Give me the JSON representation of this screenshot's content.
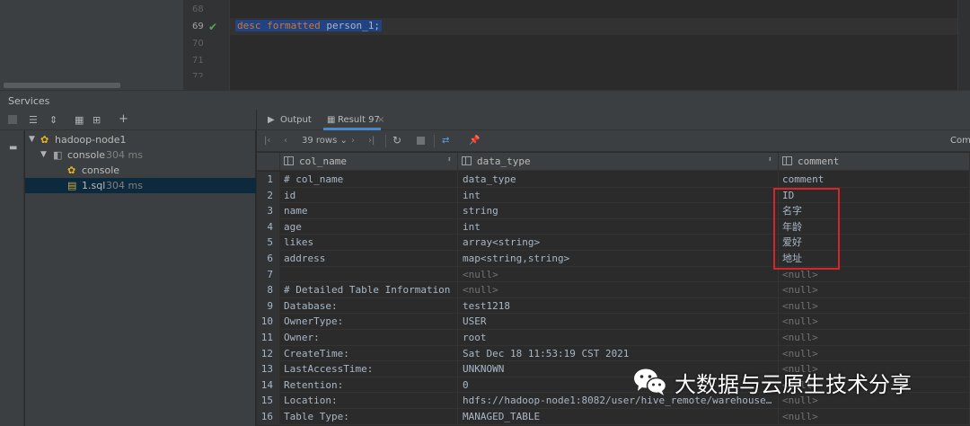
{
  "editor": {
    "lines": [
      {
        "num": "68",
        "code": ""
      },
      {
        "num": "69",
        "code": "desc formatted person_1;"
      },
      {
        "num": "70",
        "code": ""
      },
      {
        "num": "71",
        "code": ""
      }
    ],
    "keyword1": "desc",
    "keyword2": "formatted",
    "table": "person_1;"
  },
  "services": {
    "title": "Services",
    "tree": [
      {
        "label": "hadoop-node1",
        "duration": ""
      },
      {
        "label": "console",
        "duration": "304 ms"
      },
      {
        "label": "console",
        "duration": ""
      },
      {
        "label": "1.sql",
        "duration": "304 ms"
      }
    ]
  },
  "tabs": {
    "output": "Output",
    "result": "Result 97"
  },
  "result_toolbar": {
    "rows_label": "39 rows",
    "right_label": "Comm"
  },
  "grid": {
    "columns": [
      "col_name",
      "data_type",
      "comment"
    ],
    "rows": [
      {
        "n": "1",
        "col_name": "# col_name",
        "data_type": "data_type",
        "comment": "comment"
      },
      {
        "n": "2",
        "col_name": "id",
        "data_type": "int",
        "comment": "ID"
      },
      {
        "n": "3",
        "col_name": "name",
        "data_type": "string",
        "comment": "名字"
      },
      {
        "n": "4",
        "col_name": "age",
        "data_type": "int",
        "comment": "年龄"
      },
      {
        "n": "5",
        "col_name": "likes",
        "data_type": "array<string>",
        "comment": "爱好"
      },
      {
        "n": "6",
        "col_name": "address",
        "data_type": "map<string,string>",
        "comment": "地址"
      },
      {
        "n": "7",
        "col_name": "",
        "data_type": "<null>",
        "comment": "<null>"
      },
      {
        "n": "8",
        "col_name": "# Detailed Table Information",
        "data_type": "<null>",
        "comment": "<null>"
      },
      {
        "n": "9",
        "col_name": "Database:",
        "data_type": "test1218",
        "comment": "<null>"
      },
      {
        "n": "10",
        "col_name": "OwnerType:",
        "data_type": "USER",
        "comment": "<null>"
      },
      {
        "n": "11",
        "col_name": "Owner:",
        "data_type": "root",
        "comment": "<null>"
      },
      {
        "n": "12",
        "col_name": "CreateTime:",
        "data_type": "Sat Dec 18 11:53:19 CST 2021",
        "comment": "<null>"
      },
      {
        "n": "13",
        "col_name": "LastAccessTime:",
        "data_type": "UNKNOWN",
        "comment": "<null>"
      },
      {
        "n": "14",
        "col_name": "Retention:",
        "data_type": "0",
        "comment": "<null>"
      },
      {
        "n": "15",
        "col_name": "Location:",
        "data_type": "hdfs://hadoop-node1:8082/user/hive_remote/warehouse…",
        "comment": "<null>"
      },
      {
        "n": "16",
        "col_name": "Table Type:",
        "data_type": "MANAGED_TABLE",
        "comment": "<null>"
      }
    ]
  },
  "watermark": {
    "text": "大数据与云原生技术分享",
    "icon": "wechat-icon"
  },
  "colors": {
    "highlight_box": "#d7262b",
    "selection": "#214283",
    "keyword": "#cc7832",
    "check": "#4eaa4e"
  }
}
